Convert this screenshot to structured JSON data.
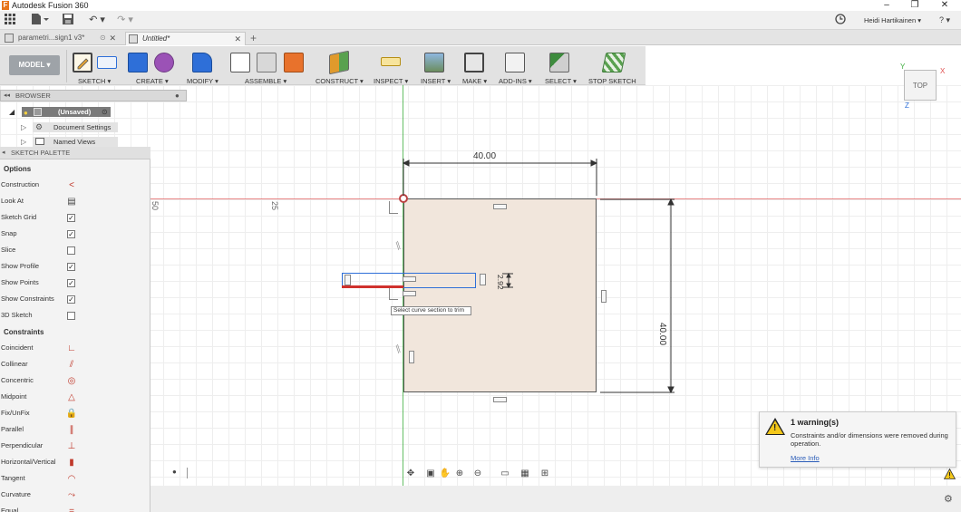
{
  "app": {
    "title": "Autodesk Fusion 360",
    "logo_letter": "F"
  },
  "window": {
    "minimize": "–",
    "maximize": "❐",
    "close": "✕"
  },
  "user": {
    "name": "Heidi Hartikainen ▾",
    "help": "? ▾"
  },
  "tabs": [
    {
      "label": "parametri...sign1 v3*"
    },
    {
      "label": "Untitled*"
    }
  ],
  "tab_close": "✕",
  "tab_add": "+",
  "ribbon": {
    "mode": "MODEL ▾",
    "groups": [
      {
        "label": "SKETCH ▾"
      },
      {
        "label": "CREATE ▾"
      },
      {
        "label": "MODIFY ▾"
      },
      {
        "label": "ASSEMBLE ▾"
      },
      {
        "label": "CONSTRUCT ▾"
      },
      {
        "label": "INSPECT ▾"
      },
      {
        "label": "INSERT ▾"
      },
      {
        "label": "MAKE ▾"
      },
      {
        "label": "ADD-INS ▾"
      },
      {
        "label": "SELECT ▾"
      },
      {
        "label": "STOP SKETCH"
      }
    ]
  },
  "browser": {
    "title": "BROWSER",
    "root": "(Unsaved)",
    "items": [
      "Document Settings",
      "Named Views"
    ]
  },
  "palette": {
    "title": "SKETCH PALETTE",
    "options_title": "Options",
    "options": [
      {
        "label": "Construction",
        "control": "icon",
        "icon": "construction-icon",
        "checked": false
      },
      {
        "label": "Look At",
        "control": "icon",
        "icon": "look-at-icon",
        "checked": false
      },
      {
        "label": "Sketch Grid",
        "control": "check",
        "checked": true
      },
      {
        "label": "Snap",
        "control": "check",
        "checked": true
      },
      {
        "label": "Slice",
        "control": "check",
        "checked": false
      },
      {
        "label": "Show Profile",
        "control": "check",
        "checked": true
      },
      {
        "label": "Show Points",
        "control": "check",
        "checked": true
      },
      {
        "label": "Show Constraints",
        "control": "check",
        "checked": true
      },
      {
        "label": "3D Sketch",
        "control": "check",
        "checked": false
      }
    ],
    "constraints_title": "Constraints",
    "constraints": [
      {
        "label": "Coincident",
        "icon": "coincident-icon"
      },
      {
        "label": "Collinear",
        "icon": "collinear-icon"
      },
      {
        "label": "Concentric",
        "icon": "concentric-icon"
      },
      {
        "label": "Midpoint",
        "icon": "midpoint-icon"
      },
      {
        "label": "Fix/UnFix",
        "icon": "fix-icon"
      },
      {
        "label": "Parallel",
        "icon": "parallel-icon"
      },
      {
        "label": "Perpendicular",
        "icon": "perpendicular-icon"
      },
      {
        "label": "Horizontal/Vertical",
        "icon": "horizontal-vertical-icon"
      },
      {
        "label": "Tangent",
        "icon": "tangent-icon"
      },
      {
        "label": "Curvature",
        "icon": "curvature-icon"
      },
      {
        "label": "Equal",
        "icon": "equal-icon"
      }
    ]
  },
  "canvas": {
    "ruler_50": "50",
    "ruler_25": "25",
    "dim_width": "40.00",
    "dim_height": "40.00",
    "dim_small": "2.92",
    "tooltip": "Select curve section to trim"
  },
  "viewcube": {
    "face": "TOP",
    "axis_x": "X",
    "axis_y": "Y",
    "axis_z": "Z"
  },
  "warning": {
    "title": "1 warning(s)",
    "message": "Constraints and/or dimensions were removed during operation.",
    "link": "More Info"
  },
  "colors": {
    "sketch_fill": "#f1e6dc",
    "axis_red": "#e05050",
    "axis_green": "#3fae3f",
    "selection_blue": "#2e6fd8",
    "trim_red": "#d0312d",
    "warning_yellow": "#f4c81a"
  }
}
